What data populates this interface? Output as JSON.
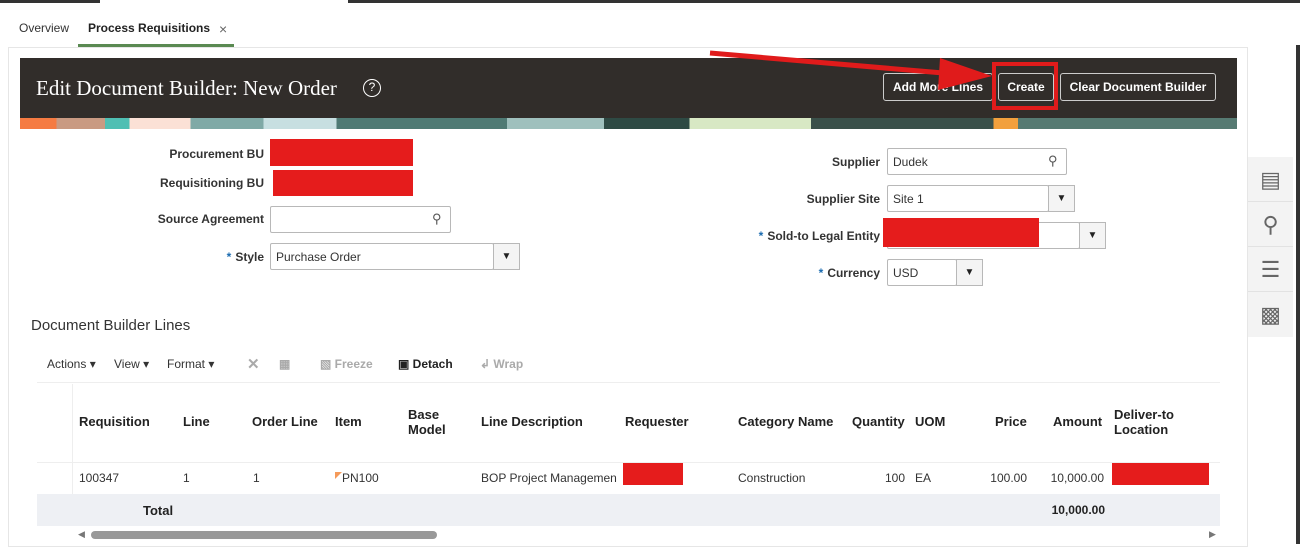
{
  "tabs": [
    {
      "label": "Overview"
    },
    {
      "label": "Process Requisitions",
      "close": "×"
    }
  ],
  "header": {
    "title": "Edit Document Builder: New Order",
    "help": "?",
    "buttons": {
      "add_more_lines": "Add More Lines",
      "create": "Create",
      "clear": "Clear Document Builder"
    }
  },
  "form": {
    "procurement_bu": {
      "label": "Procurement BU"
    },
    "requisitioning_bu": {
      "label": "Requisitioning BU"
    },
    "source_agreement": {
      "label": "Source Agreement",
      "value": ""
    },
    "style": {
      "label": "Style",
      "value": "Purchase Order"
    },
    "supplier": {
      "label": "Supplier",
      "value": "Dudek"
    },
    "supplier_site": {
      "label": "Supplier Site",
      "value": "Site 1"
    },
    "sold_to": {
      "label": "Sold-to Legal Entity"
    },
    "currency": {
      "label": "Currency",
      "value": "USD"
    },
    "required_mark": "*"
  },
  "lines": {
    "title": "Document Builder Lines",
    "toolbar": {
      "actions": "Actions",
      "view": "View",
      "format": "Format",
      "freeze": "Freeze",
      "detach": "Detach",
      "wrap": "Wrap"
    },
    "columns": [
      "Requisition",
      "Line",
      "Order Line",
      "Item",
      "Base Model",
      "Line Description",
      "Requester",
      "Category Name",
      "Quantity",
      "UOM",
      "Price",
      "Amount",
      "Deliver-to Location"
    ],
    "rows": [
      {
        "requisition": "100347",
        "line": "1",
        "order_line": "1",
        "item": "PN100",
        "base_model": "",
        "description": "BOP Project Managemen",
        "category": "Construction",
        "quantity": "100",
        "uom": "EA",
        "price": "100.00",
        "amount": "10,000.00"
      }
    ],
    "total_label": "Total",
    "total_amount": "10,000.00"
  }
}
